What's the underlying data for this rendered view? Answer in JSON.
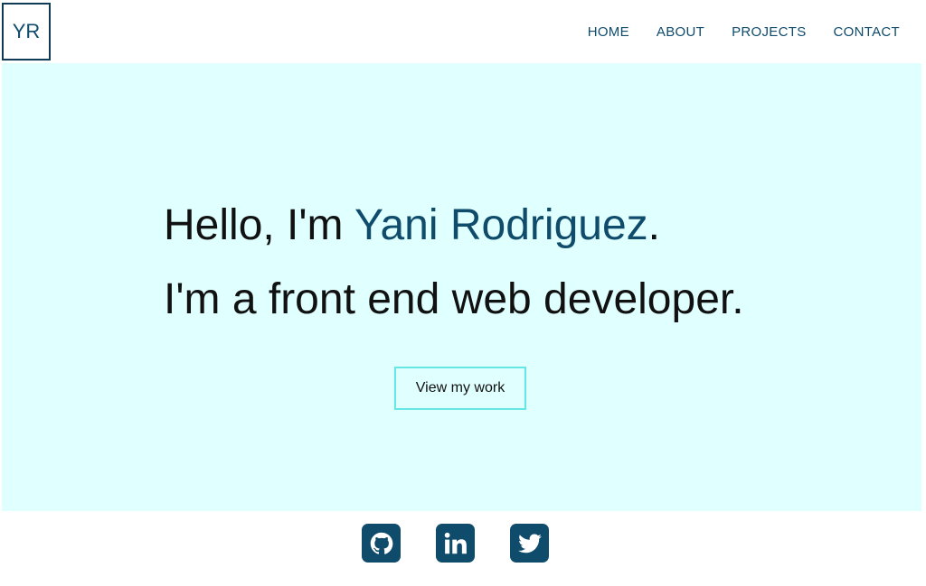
{
  "header": {
    "logo_text": "YR",
    "nav": [
      {
        "label": "HOME"
      },
      {
        "label": "ABOUT"
      },
      {
        "label": "PROJECTS"
      },
      {
        "label": "CONTACT"
      }
    ]
  },
  "hero": {
    "line1_prefix": "Hello, I'm ",
    "name": "Yani Rodriguez",
    "line1_suffix": ".",
    "line2": "I'm a front end web developer.",
    "cta_label": "View my work"
  },
  "social": [
    {
      "icon": "github-icon"
    },
    {
      "icon": "linkedin-icon"
    },
    {
      "icon": "twitter-icon"
    }
  ],
  "colors": {
    "accent": "#0f4b6b",
    "hero_background": "#e0ffff",
    "button_border": "#67e6e6"
  }
}
